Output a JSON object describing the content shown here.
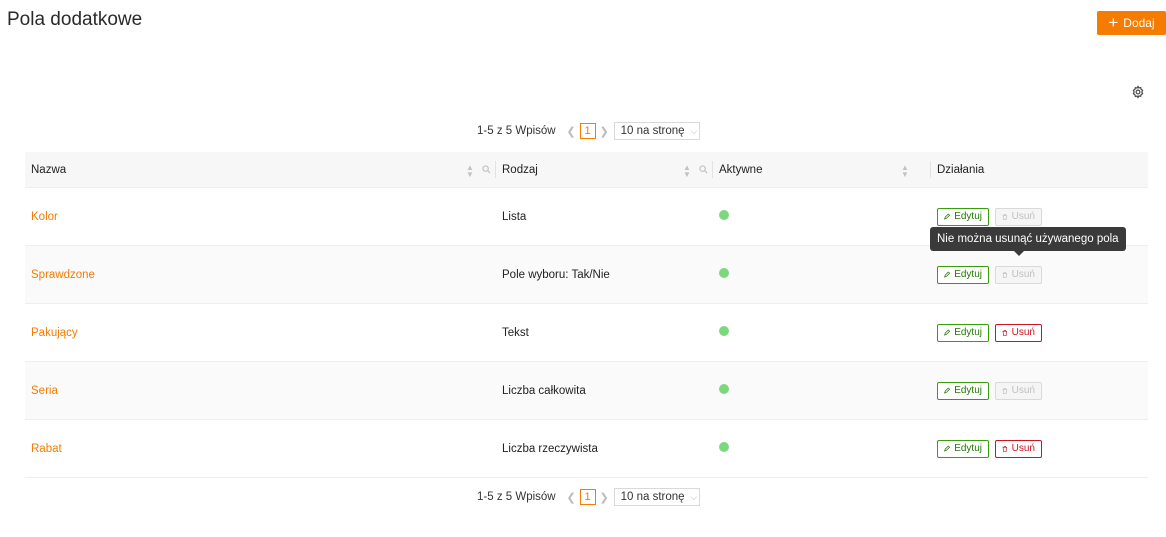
{
  "page": {
    "title": "Pola dodatkowe"
  },
  "toolbar": {
    "add_label": "Dodaj"
  },
  "pagination": {
    "total_text": "1-5 z 5 Wpisów",
    "current_page": "1",
    "page_size": "10 na stronę"
  },
  "table": {
    "columns": [
      "Nazwa",
      "Rodzaj",
      "Aktywne",
      "Działania"
    ],
    "rows": [
      {
        "name": "Kolor",
        "type": "Lista",
        "active": true,
        "edit": "Edytuj",
        "delete": "Usuń",
        "delete_enabled": false
      },
      {
        "name": "Sprawdzone",
        "type": "Pole wyboru: Tak/Nie",
        "active": true,
        "edit": "Edytuj",
        "delete": "Usuń",
        "delete_enabled": false
      },
      {
        "name": "Pakujący",
        "type": "Tekst",
        "active": true,
        "edit": "Edytuj",
        "delete": "Usuń",
        "delete_enabled": true
      },
      {
        "name": "Seria",
        "type": "Liczba całkowita",
        "active": true,
        "edit": "Edytuj",
        "delete": "Usuń",
        "delete_enabled": false
      },
      {
        "name": "Rabat",
        "type": "Liczba rzeczywista",
        "active": true,
        "edit": "Edytuj",
        "delete": "Usuń",
        "delete_enabled": true
      }
    ]
  },
  "tooltip": {
    "text": "Nie można usunąć używanego pola"
  },
  "colors": {
    "accent": "#f57c00",
    "active_dot": "#7dd87d",
    "edit": "#389e0d",
    "delete": "#cf1322"
  },
  "icons": [
    "plus-icon",
    "gear-icon",
    "sort-icon",
    "search-icon",
    "pencil-icon",
    "trash-icon",
    "chevron-left-icon",
    "chevron-right-icon",
    "chevron-down-icon"
  ]
}
